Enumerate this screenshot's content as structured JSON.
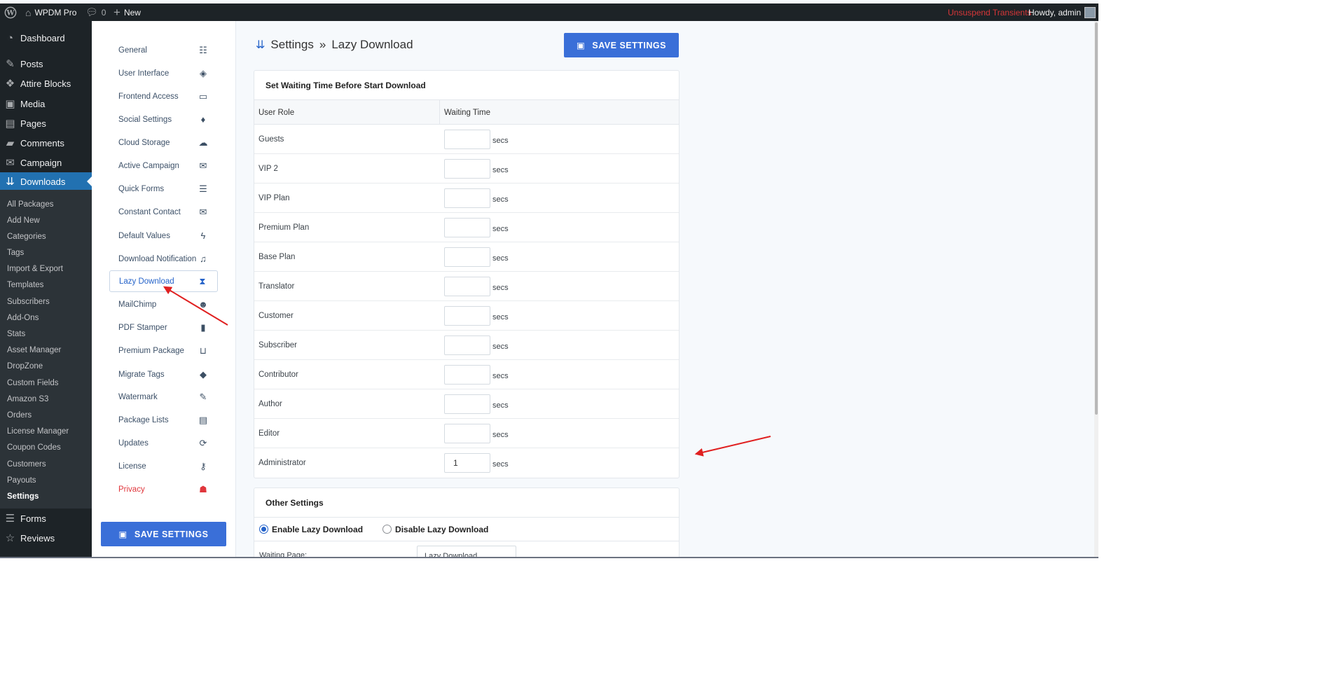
{
  "adminbar": {
    "site_name": "WPDM Pro",
    "comments_count": "0",
    "new_label": "New",
    "unsuspend": "Unsuspend Transients",
    "howdy": "Howdy, admin"
  },
  "wp_menu": {
    "dashboard": "Dashboard",
    "posts": "Posts",
    "attire_blocks": "Attire Blocks",
    "media": "Media",
    "pages": "Pages",
    "comments": "Comments",
    "campaign": "Campaign",
    "downloads": "Downloads",
    "forms": "Forms",
    "reviews": "Reviews",
    "submenu": [
      "All Packages",
      "Add New",
      "Categories",
      "Tags",
      "Import & Export",
      "Templates",
      "Subscribers",
      "Add-Ons",
      "Stats",
      "Asset Manager",
      "DropZone",
      "Custom Fields",
      "Amazon S3",
      "Orders",
      "License Manager",
      "Coupon Codes",
      "Customers",
      "Payouts",
      "Settings"
    ]
  },
  "settings_nav": {
    "items": [
      "General",
      "User Interface",
      "Frontend Access",
      "Social Settings",
      "Cloud Storage",
      "Active Campaign",
      "Quick Forms",
      "Constant Contact",
      "Default Values",
      "Download Notification",
      "Lazy Download",
      "MailChimp",
      "PDF Stamper",
      "Premium Package",
      "Migrate Tags",
      "Watermark",
      "Package Lists",
      "Updates",
      "License",
      "Privacy"
    ],
    "icons": [
      "sliders-icon",
      "paint-bucket-icon",
      "desktop-icon",
      "twitter-icon",
      "cloud-upload-icon",
      "envelope-icon",
      "list-icon",
      "envelope-icon",
      "bolt-icon",
      "bell-icon",
      "hourglass-icon",
      "mailchimp-icon",
      "pdf-file-icon",
      "basket-icon",
      "tags-icon",
      "pencil-icon",
      "list-alt-icon",
      "sync-icon",
      "key-icon",
      "user-shield-icon"
    ],
    "save_label": "SAVE SETTINGS"
  },
  "main": {
    "title": "Settings",
    "subtitle": "Lazy Download",
    "save_label": "SAVE SETTINGS",
    "waiting_card": {
      "heading": "Set Waiting Time Before Start Download",
      "col_role": "User Role",
      "col_time": "Waiting Time",
      "unit": "secs",
      "rows": [
        {
          "role": "Guests",
          "value": ""
        },
        {
          "role": "VIP 2",
          "value": ""
        },
        {
          "role": "VIP Plan",
          "value": ""
        },
        {
          "role": "Premium Plan",
          "value": ""
        },
        {
          "role": "Base Plan",
          "value": ""
        },
        {
          "role": "Translator",
          "value": ""
        },
        {
          "role": "Customer",
          "value": ""
        },
        {
          "role": "Subscriber",
          "value": ""
        },
        {
          "role": "Contributor",
          "value": ""
        },
        {
          "role": "Author",
          "value": ""
        },
        {
          "role": "Editor",
          "value": ""
        },
        {
          "role": "Administrator",
          "value": "1"
        }
      ]
    },
    "other_card": {
      "heading": "Other Settings",
      "enable_label": "Enable Lazy Download",
      "disable_label": "Disable Lazy Download",
      "waiting_page_label": "Waiting Page:",
      "waiting_page_value": "Lazy Download"
    }
  },
  "colors": {
    "accent": "#3a6fd8",
    "wp_dark": "#1d2327",
    "wp_blue": "#2271b1",
    "annotation": "#e02020"
  }
}
